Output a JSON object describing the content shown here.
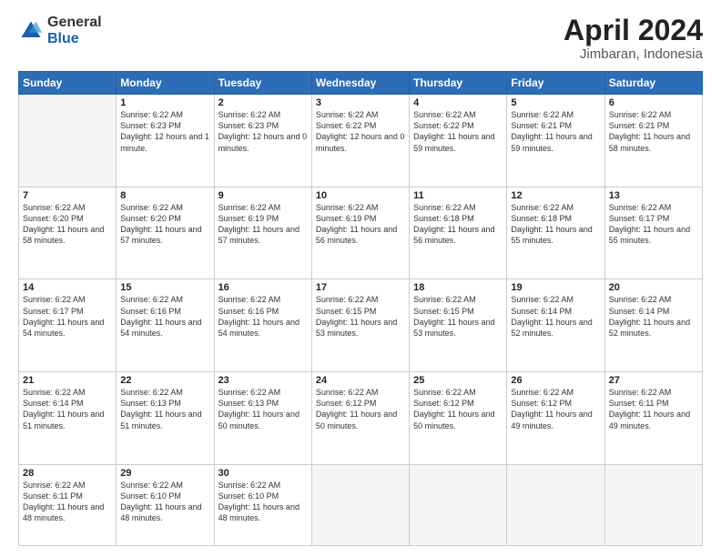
{
  "logo": {
    "general": "General",
    "blue": "Blue"
  },
  "header": {
    "title": "April 2024",
    "subtitle": "Jimbaran, Indonesia"
  },
  "weekdays": [
    "Sunday",
    "Monday",
    "Tuesday",
    "Wednesday",
    "Thursday",
    "Friday",
    "Saturday"
  ],
  "weeks": [
    [
      {
        "day": "",
        "empty": true
      },
      {
        "day": "1",
        "sunrise": "6:22 AM",
        "sunset": "6:23 PM",
        "daylight": "12 hours and 1 minute."
      },
      {
        "day": "2",
        "sunrise": "6:22 AM",
        "sunset": "6:23 PM",
        "daylight": "12 hours and 0 minutes."
      },
      {
        "day": "3",
        "sunrise": "6:22 AM",
        "sunset": "6:22 PM",
        "daylight": "12 hours and 0 minutes."
      },
      {
        "day": "4",
        "sunrise": "6:22 AM",
        "sunset": "6:22 PM",
        "daylight": "11 hours and 59 minutes."
      },
      {
        "day": "5",
        "sunrise": "6:22 AM",
        "sunset": "6:21 PM",
        "daylight": "11 hours and 59 minutes."
      },
      {
        "day": "6",
        "sunrise": "6:22 AM",
        "sunset": "6:21 PM",
        "daylight": "11 hours and 58 minutes."
      }
    ],
    [
      {
        "day": "7",
        "sunrise": "6:22 AM",
        "sunset": "6:20 PM",
        "daylight": "11 hours and 58 minutes."
      },
      {
        "day": "8",
        "sunrise": "6:22 AM",
        "sunset": "6:20 PM",
        "daylight": "11 hours and 57 minutes."
      },
      {
        "day": "9",
        "sunrise": "6:22 AM",
        "sunset": "6:19 PM",
        "daylight": "11 hours and 57 minutes."
      },
      {
        "day": "10",
        "sunrise": "6:22 AM",
        "sunset": "6:19 PM",
        "daylight": "11 hours and 56 minutes."
      },
      {
        "day": "11",
        "sunrise": "6:22 AM",
        "sunset": "6:18 PM",
        "daylight": "11 hours and 56 minutes."
      },
      {
        "day": "12",
        "sunrise": "6:22 AM",
        "sunset": "6:18 PM",
        "daylight": "11 hours and 55 minutes."
      },
      {
        "day": "13",
        "sunrise": "6:22 AM",
        "sunset": "6:17 PM",
        "daylight": "11 hours and 55 minutes."
      }
    ],
    [
      {
        "day": "14",
        "sunrise": "6:22 AM",
        "sunset": "6:17 PM",
        "daylight": "11 hours and 54 minutes."
      },
      {
        "day": "15",
        "sunrise": "6:22 AM",
        "sunset": "6:16 PM",
        "daylight": "11 hours and 54 minutes."
      },
      {
        "day": "16",
        "sunrise": "6:22 AM",
        "sunset": "6:16 PM",
        "daylight": "11 hours and 54 minutes."
      },
      {
        "day": "17",
        "sunrise": "6:22 AM",
        "sunset": "6:15 PM",
        "daylight": "11 hours and 53 minutes."
      },
      {
        "day": "18",
        "sunrise": "6:22 AM",
        "sunset": "6:15 PM",
        "daylight": "11 hours and 53 minutes."
      },
      {
        "day": "19",
        "sunrise": "6:22 AM",
        "sunset": "6:14 PM",
        "daylight": "11 hours and 52 minutes."
      },
      {
        "day": "20",
        "sunrise": "6:22 AM",
        "sunset": "6:14 PM",
        "daylight": "11 hours and 52 minutes."
      }
    ],
    [
      {
        "day": "21",
        "sunrise": "6:22 AM",
        "sunset": "6:14 PM",
        "daylight": "11 hours and 51 minutes."
      },
      {
        "day": "22",
        "sunrise": "6:22 AM",
        "sunset": "6:13 PM",
        "daylight": "11 hours and 51 minutes."
      },
      {
        "day": "23",
        "sunrise": "6:22 AM",
        "sunset": "6:13 PM",
        "daylight": "11 hours and 50 minutes."
      },
      {
        "day": "24",
        "sunrise": "6:22 AM",
        "sunset": "6:12 PM",
        "daylight": "11 hours and 50 minutes."
      },
      {
        "day": "25",
        "sunrise": "6:22 AM",
        "sunset": "6:12 PM",
        "daylight": "11 hours and 50 minutes."
      },
      {
        "day": "26",
        "sunrise": "6:22 AM",
        "sunset": "6:12 PM",
        "daylight": "11 hours and 49 minutes."
      },
      {
        "day": "27",
        "sunrise": "6:22 AM",
        "sunset": "6:11 PM",
        "daylight": "11 hours and 49 minutes."
      }
    ],
    [
      {
        "day": "28",
        "sunrise": "6:22 AM",
        "sunset": "6:11 PM",
        "daylight": "11 hours and 48 minutes."
      },
      {
        "day": "29",
        "sunrise": "6:22 AM",
        "sunset": "6:10 PM",
        "daylight": "11 hours and 48 minutes."
      },
      {
        "day": "30",
        "sunrise": "6:22 AM",
        "sunset": "6:10 PM",
        "daylight": "11 hours and 48 minutes."
      },
      {
        "day": "",
        "empty": true
      },
      {
        "day": "",
        "empty": true
      },
      {
        "day": "",
        "empty": true
      },
      {
        "day": "",
        "empty": true
      }
    ]
  ],
  "labels": {
    "sunrise": "Sunrise:",
    "sunset": "Sunset:",
    "daylight": "Daylight:"
  }
}
